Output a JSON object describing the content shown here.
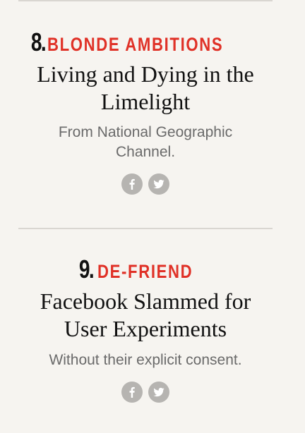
{
  "stories": [
    {
      "rank": "8.",
      "category": "BLONDE AMBITIONS",
      "headline_lines": [
        "Living and Dying in the",
        "Limelight"
      ],
      "dek_lines": [
        "From National Geographic",
        "Channel."
      ],
      "share_icons": [
        "facebook-icon",
        "twitter-icon"
      ]
    },
    {
      "rank": "9.",
      "category": "DE-FRIEND",
      "headline_lines": [
        "Facebook Slammed for",
        "User Experiments"
      ],
      "dek_lines": [
        "Without their explicit consent."
      ],
      "share_icons": [
        "facebook-icon",
        "twitter-icon"
      ]
    }
  ],
  "colors": {
    "background": "#f6f4f0",
    "category": "#e03127",
    "headline": "#111111",
    "dek": "#6a6a6a",
    "share_button": "#b6b4b1",
    "divider": "#d9d6d1"
  }
}
